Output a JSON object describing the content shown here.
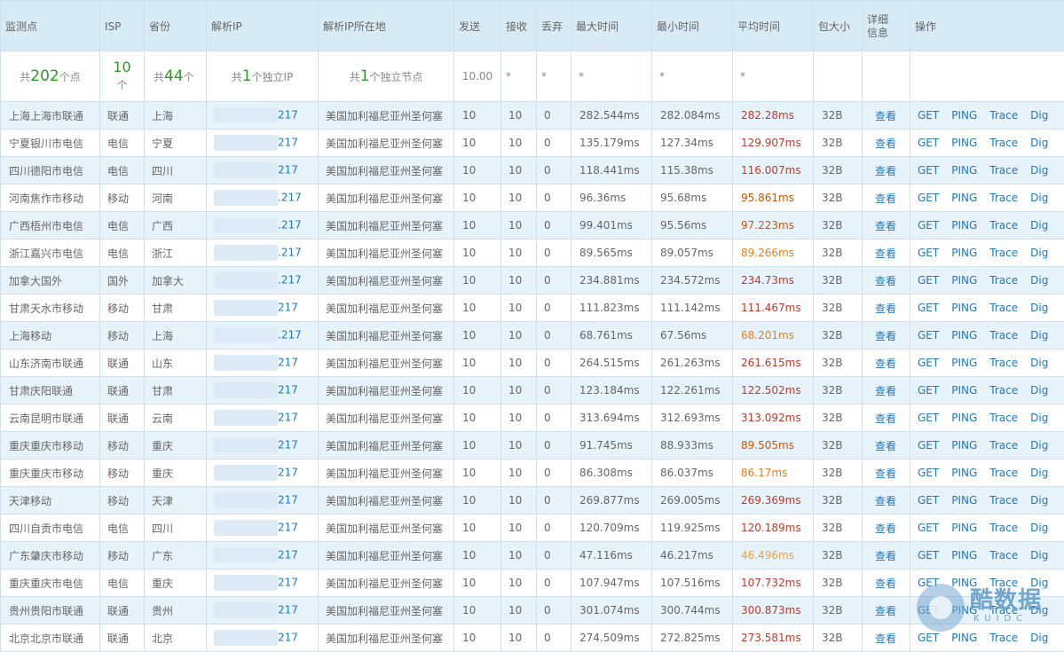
{
  "headers": {
    "monitor_point": "监测点",
    "isp": "ISP",
    "province": "省份",
    "resolve_ip": "解析IP",
    "resolve_ip_location": "解析IP所在地",
    "sent": "发送",
    "received": "接收",
    "lost": "丢弃",
    "max_time": "最大时间",
    "min_time": "最小时间",
    "avg_time": "平均时间",
    "packet_size": "包大小",
    "details": "详细信息",
    "actions": "操作"
  },
  "summary": {
    "points_prefix": "共",
    "points_value": "202",
    "points_suffix": "个点",
    "isp_value": "10",
    "isp_suffix": "个",
    "province_prefix": "共",
    "province_value": "44",
    "province_suffix": "个",
    "ip_prefix": "共",
    "ip_value": "1",
    "ip_suffix": "个独立IP",
    "node_prefix": "共",
    "node_value": "1",
    "node_suffix": "个独立节点",
    "sent": "10.00",
    "received": "*",
    "lost": "*",
    "max": "*",
    "min": "*",
    "avg": "*"
  },
  "labels": {
    "view": "查看",
    "get": "GET",
    "ping": "PING",
    "trace": "Trace",
    "dig": "Dig"
  },
  "rows": [
    {
      "point": "上海上海市联通",
      "isp": "联通",
      "province": "上海",
      "ip": "217",
      "location": "美国加利福尼亚州圣何塞",
      "sent": "10",
      "recv": "10",
      "lost": "0",
      "max": "282.544ms",
      "min": "282.084ms",
      "avg": "282.28ms",
      "avg_color": "#c0392b",
      "size": "32B"
    },
    {
      "point": "宁夏银川市电信",
      "isp": "电信",
      "province": "宁夏",
      "ip": "217",
      "location": "美国加利福尼亚州圣何塞",
      "sent": "10",
      "recv": "10",
      "lost": "0",
      "max": "135.179ms",
      "min": "127.34ms",
      "avg": "129.907ms",
      "avg_color": "#c0392b",
      "size": "32B"
    },
    {
      "point": "四川德阳市电信",
      "isp": "电信",
      "province": "四川",
      "ip": "217",
      "location": "美国加利福尼亚州圣何塞",
      "sent": "10",
      "recv": "10",
      "lost": "0",
      "max": "118.441ms",
      "min": "115.38ms",
      "avg": "116.007ms",
      "avg_color": "#c0392b",
      "size": "32B"
    },
    {
      "point": "河南焦作市移动",
      "isp": "移动",
      "province": "河南",
      "ip": ".217",
      "location": "美国加利福尼亚州圣何塞",
      "sent": "10",
      "recv": "10",
      "lost": "0",
      "max": "96.36ms",
      "min": "95.68ms",
      "avg": "95.861ms",
      "avg_color": "#d35400",
      "size": "32B"
    },
    {
      "point": "广西梧州市电信",
      "isp": "电信",
      "province": "广西",
      "ip": ".217",
      "location": "美国加利福尼亚州圣何塞",
      "sent": "10",
      "recv": "10",
      "lost": "0",
      "max": "99.401ms",
      "min": "95.56ms",
      "avg": "97.223ms",
      "avg_color": "#d35400",
      "size": "32B"
    },
    {
      "point": "浙江嘉兴市电信",
      "isp": "电信",
      "province": "浙江",
      "ip": ".217",
      "location": "美国加利福尼亚州圣何塞",
      "sent": "10",
      "recv": "10",
      "lost": "0",
      "max": "89.565ms",
      "min": "89.057ms",
      "avg": "89.266ms",
      "avg_color": "#e67e22",
      "size": "32B"
    },
    {
      "point": "加拿大国外",
      "isp": "国外",
      "province": "加拿大",
      "ip": ".217",
      "location": "美国加利福尼亚州圣何塞",
      "sent": "10",
      "recv": "10",
      "lost": "0",
      "max": "234.881ms",
      "min": "234.572ms",
      "avg": "234.73ms",
      "avg_color": "#c0392b",
      "size": "32B"
    },
    {
      "point": "甘肃天水市移动",
      "isp": "移动",
      "province": "甘肃",
      "ip": "217",
      "location": "美国加利福尼亚州圣何塞",
      "sent": "10",
      "recv": "10",
      "lost": "0",
      "max": "111.823ms",
      "min": "111.142ms",
      "avg": "111.467ms",
      "avg_color": "#c0392b",
      "size": "32B"
    },
    {
      "point": "上海移动",
      "isp": "移动",
      "province": "上海",
      "ip": ".217",
      "location": "美国加利福尼亚州圣何塞",
      "sent": "10",
      "recv": "10",
      "lost": "0",
      "max": "68.761ms",
      "min": "67.56ms",
      "avg": "68.201ms",
      "avg_color": "#e67e22",
      "size": "32B"
    },
    {
      "point": "山东济南市联通",
      "isp": "联通",
      "province": "山东",
      "ip": "217",
      "location": "美国加利福尼亚州圣何塞",
      "sent": "10",
      "recv": "10",
      "lost": "0",
      "max": "264.515ms",
      "min": "261.263ms",
      "avg": "261.615ms",
      "avg_color": "#c0392b",
      "size": "32B"
    },
    {
      "point": "甘肃庆阳联通",
      "isp": "联通",
      "province": "甘肃",
      "ip": "217",
      "location": "美国加利福尼亚州圣何塞",
      "sent": "10",
      "recv": "10",
      "lost": "0",
      "max": "123.184ms",
      "min": "122.261ms",
      "avg": "122.502ms",
      "avg_color": "#c0392b",
      "size": "32B"
    },
    {
      "point": "云南昆明市联通",
      "isp": "联通",
      "province": "云南",
      "ip": "217",
      "location": "美国加利福尼亚州圣何塞",
      "sent": "10",
      "recv": "10",
      "lost": "0",
      "max": "313.694ms",
      "min": "312.693ms",
      "avg": "313.092ms",
      "avg_color": "#c0392b",
      "size": "32B"
    },
    {
      "point": "重庆重庆市移动",
      "isp": "移动",
      "province": "重庆",
      "ip": "217",
      "location": "美国加利福尼亚州圣何塞",
      "sent": "10",
      "recv": "10",
      "lost": "0",
      "max": "91.745ms",
      "min": "88.933ms",
      "avg": "89.505ms",
      "avg_color": "#d35400",
      "size": "32B"
    },
    {
      "point": "重庆重庆市移动",
      "isp": "移动",
      "province": "重庆",
      "ip": "217",
      "location": "美国加利福尼亚州圣何塞",
      "sent": "10",
      "recv": "10",
      "lost": "0",
      "max": "86.308ms",
      "min": "86.037ms",
      "avg": "86.17ms",
      "avg_color": "#e67e22",
      "size": "32B"
    },
    {
      "point": "天津移动",
      "isp": "移动",
      "province": "天津",
      "ip": "217",
      "location": "美国加利福尼亚州圣何塞",
      "sent": "10",
      "recv": "10",
      "lost": "0",
      "max": "269.877ms",
      "min": "269.005ms",
      "avg": "269.369ms",
      "avg_color": "#c0392b",
      "size": "32B"
    },
    {
      "point": "四川自贡市电信",
      "isp": "电信",
      "province": "四川",
      "ip": "217",
      "location": "美国加利福尼亚州圣何塞",
      "sent": "10",
      "recv": "10",
      "lost": "0",
      "max": "120.709ms",
      "min": "119.925ms",
      "avg": "120.189ms",
      "avg_color": "#c0392b",
      "size": "32B"
    },
    {
      "point": "广东肇庆市移动",
      "isp": "移动",
      "province": "广东",
      "ip": "217",
      "location": "美国加利福尼亚州圣何塞",
      "sent": "10",
      "recv": "10",
      "lost": "0",
      "max": "47.116ms",
      "min": "46.217ms",
      "avg": "46.496ms",
      "avg_color": "#f0a030",
      "size": "32B"
    },
    {
      "point": "重庆重庆市电信",
      "isp": "电信",
      "province": "重庆",
      "ip": "217",
      "location": "美国加利福尼亚州圣何塞",
      "sent": "10",
      "recv": "10",
      "lost": "0",
      "max": "107.947ms",
      "min": "107.516ms",
      "avg": "107.732ms",
      "avg_color": "#c0392b",
      "size": "32B"
    },
    {
      "point": "贵州贵阳市联通",
      "isp": "联通",
      "province": "贵州",
      "ip": "217",
      "location": "美国加利福尼亚州圣何塞",
      "sent": "10",
      "recv": "10",
      "lost": "0",
      "max": "301.074ms",
      "min": "300.744ms",
      "avg": "300.873ms",
      "avg_color": "#c0392b",
      "size": "32B"
    },
    {
      "point": "北京北京市联通",
      "isp": "联通",
      "province": "北京",
      "ip": "217",
      "location": "美国加利福尼亚州圣何塞",
      "sent": "10",
      "recv": "10",
      "lost": "0",
      "max": "274.509ms",
      "min": "272.825ms",
      "avg": "273.581ms",
      "avg_color": "#c0392b",
      "size": "32B"
    }
  ],
  "watermark": {
    "title": "酷数据",
    "sub": "KUIDC"
  }
}
